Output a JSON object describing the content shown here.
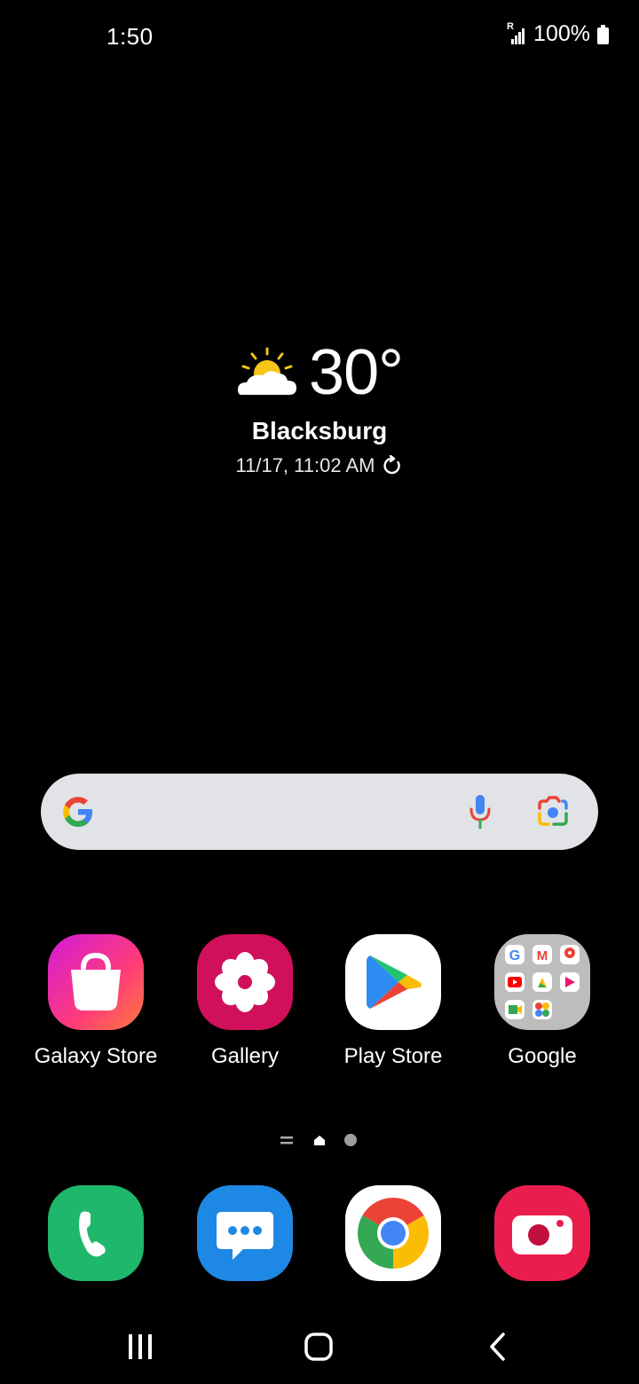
{
  "status_bar": {
    "time": "1:50",
    "battery_text": "100%",
    "signal_label": "R"
  },
  "weather": {
    "temperature": "30°",
    "city": "Blacksburg",
    "updated": "11/17, 11:02 AM",
    "condition_icon": "partly-sunny-icon"
  },
  "search": {
    "provider": "Google",
    "icons": [
      "google-logo-icon",
      "microphone-icon",
      "google-lens-icon"
    ]
  },
  "apps": [
    {
      "label": "Galaxy Store",
      "icon": "galaxy-store-icon",
      "color": "#e91e63"
    },
    {
      "label": "Gallery",
      "icon": "gallery-flower-icon",
      "color": "#d81b60"
    },
    {
      "label": "Play Store",
      "icon": "play-store-icon",
      "color": "#ffffff"
    },
    {
      "label": "Google",
      "icon": "google-folder-icon",
      "color": "#bdbdbd"
    }
  ],
  "dock": [
    {
      "name": "Phone",
      "icon": "phone-icon",
      "color": "#1fb76b"
    },
    {
      "name": "Messages",
      "icon": "messages-icon",
      "color": "#1e88e5"
    },
    {
      "name": "Chrome",
      "icon": "chrome-icon",
      "color": "#ffffff"
    },
    {
      "name": "Camera",
      "icon": "camera-icon",
      "color": "#e91e4f"
    }
  ],
  "page_indicator": {
    "pages": 2,
    "current": 1
  },
  "nav_bar": {
    "buttons": [
      "recents-icon",
      "home-icon",
      "back-icon"
    ]
  }
}
